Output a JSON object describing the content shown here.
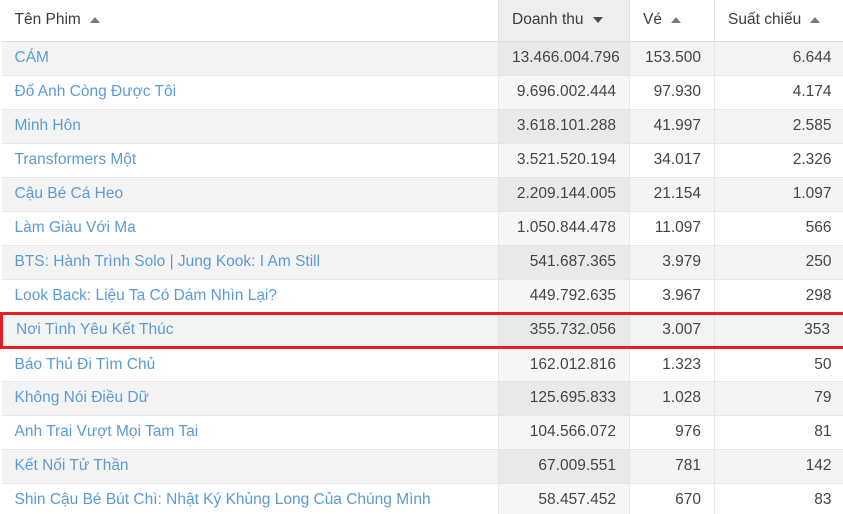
{
  "table": {
    "columns": [
      {
        "key": "name",
        "label": "Tên Phim",
        "sort": "asc",
        "align": "left",
        "sorted_active": false
      },
      {
        "key": "revenue",
        "label": "Doanh thu",
        "sort": "desc",
        "align": "right",
        "sorted_active": true
      },
      {
        "key": "tickets",
        "label": "Vé",
        "sort": "asc",
        "align": "right",
        "sorted_active": false
      },
      {
        "key": "shows",
        "label": "Suất chiếu",
        "sort": "asc",
        "align": "right",
        "sorted_active": false
      }
    ],
    "highlight_color": "#ec1c24",
    "link_color": "#5b9bd5",
    "rows": [
      {
        "name": "CÁM",
        "revenue": "13.466.004.796",
        "tickets": "153.500",
        "shows": "6.644",
        "highlighted": false
      },
      {
        "name": "Đố Anh Còng Được Tôi",
        "revenue": "9.696.002.444",
        "tickets": "97.930",
        "shows": "4.174",
        "highlighted": false
      },
      {
        "name": "Minh Hôn",
        "revenue": "3.618.101.288",
        "tickets": "41.997",
        "shows": "2.585",
        "highlighted": false
      },
      {
        "name": "Transformers Một",
        "revenue": "3.521.520.194",
        "tickets": "34.017",
        "shows": "2.326",
        "highlighted": false
      },
      {
        "name": "Cậu Bé Cá Heo",
        "revenue": "2.209.144.005",
        "tickets": "21.154",
        "shows": "1.097",
        "highlighted": false
      },
      {
        "name": "Làm Giàu Với Ma",
        "revenue": "1.050.844.478",
        "tickets": "11.097",
        "shows": "566",
        "highlighted": false
      },
      {
        "name": "BTS: Hành Trình Solo | Jung Kook: I Am Still",
        "revenue": "541.687.365",
        "tickets": "3.979",
        "shows": "250",
        "highlighted": false
      },
      {
        "name": "Look Back: Liệu Ta Có Dám Nhìn Lại?",
        "revenue": "449.792.635",
        "tickets": "3.967",
        "shows": "298",
        "highlighted": false
      },
      {
        "name": "Nơi Tình Yêu Kết Thúc",
        "revenue": "355.732.056",
        "tickets": "3.007",
        "shows": "353",
        "highlighted": true
      },
      {
        "name": "Báo Thủ Đi Tìm Chủ",
        "revenue": "162.012.816",
        "tickets": "1.323",
        "shows": "50",
        "highlighted": false
      },
      {
        "name": "Không Nói Điều Dữ",
        "revenue": "125.695.833",
        "tickets": "1.028",
        "shows": "79",
        "highlighted": false
      },
      {
        "name": "Anh Trai Vượt Mọi Tam Tai",
        "revenue": "104.566.072",
        "tickets": "976",
        "shows": "81",
        "highlighted": false
      },
      {
        "name": "Kết Nối Tử Thần",
        "revenue": "67.009.551",
        "tickets": "781",
        "shows": "142",
        "highlighted": false
      },
      {
        "name": "Shin Cậu Bé Bút Chì: Nhật Ký Khủng Long Của Chúng Mình",
        "revenue": "58.457.452",
        "tickets": "670",
        "shows": "83",
        "highlighted": false
      }
    ]
  }
}
